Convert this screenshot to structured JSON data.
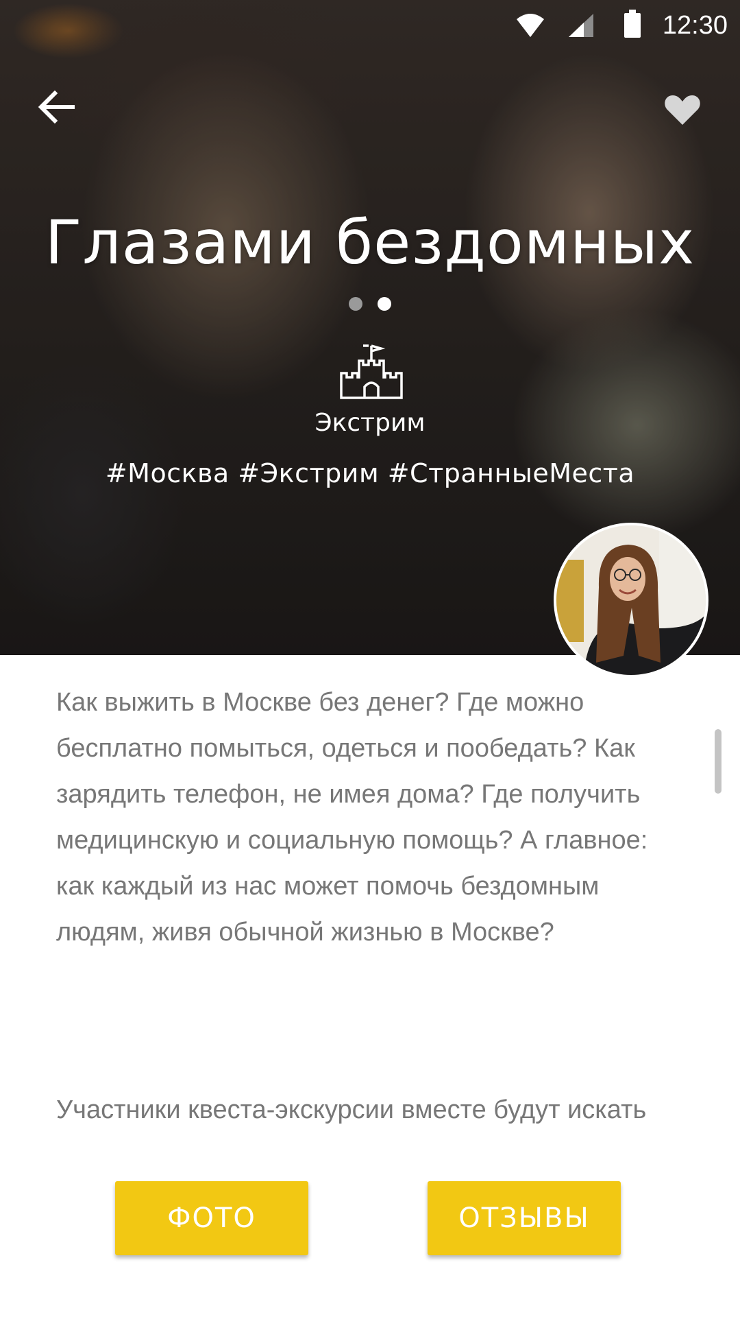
{
  "status_bar": {
    "time": "12:30",
    "icons": [
      "wifi-icon",
      "signal-icon",
      "battery-icon"
    ]
  },
  "header": {
    "back_icon": "arrow-left-icon",
    "favorite_icon": "heart-icon"
  },
  "hero": {
    "title": "Глазами бездомных",
    "slides": {
      "count": 2,
      "active_index": 1
    },
    "category": {
      "icon": "castle-icon",
      "label": "Экстрим"
    },
    "hashtags": "#Москва #Экстрим #СтранныеМеста",
    "author_avatar": "avatar"
  },
  "description": {
    "paragraph_1": "Как выжить в Москве без денег? Где можно бесплатно помыться, одеться и пообедать? Как зарядить телефон, не имея дома? Где получить медицинскую и социальную помощь? А главное: как каждый из нас может помочь бездомным людям, живя обычной жизнью в Москве?",
    "paragraph_2": "Участники квеста-экскурсии вместе будут искать ответы, скрытые на площадях и"
  },
  "actions": {
    "photo_label": "ФОТО",
    "reviews_label": "ОТЗЫВЫ"
  },
  "colors": {
    "accent": "#f2c813",
    "body_text": "#777777",
    "hero_text": "#ffffff"
  }
}
